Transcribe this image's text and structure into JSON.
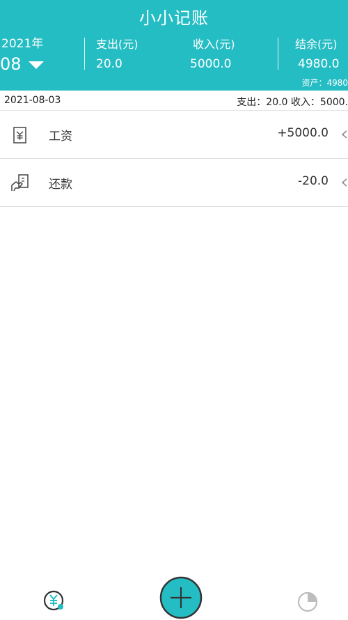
{
  "app": {
    "title": "小小记账"
  },
  "period": {
    "year": "2021年",
    "month": "08"
  },
  "summary": {
    "expense_label": "支出(元)",
    "expense_value": "20.0",
    "income_label": "收入(元)",
    "income_value": "5000.0",
    "balance_label": "结余(元)",
    "balance_value": "4980.0",
    "assets": "资产：4980"
  },
  "day": {
    "date": "2021-08-03",
    "summary": "支出：20.0 收入：5000."
  },
  "records": [
    {
      "name": "工资",
      "amount": "+5000.0",
      "icon": "salary-yuan-icon"
    },
    {
      "name": "还款",
      "amount": "-20.0",
      "icon": "repayment-hand-icon"
    }
  ],
  "nav": {
    "left_icon": "yuan-coin-icon",
    "center_icon": "add-plus-icon",
    "right_icon": "pie-chart-icon"
  },
  "colors": {
    "accent": "#25bdc4",
    "nav_icon": "#333333",
    "pie_icon": "#bdbdbd"
  }
}
